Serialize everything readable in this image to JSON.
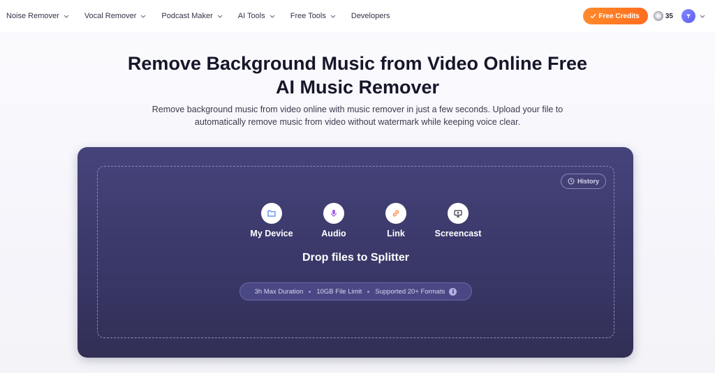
{
  "nav": {
    "items": [
      {
        "label": "Noise Remover",
        "dropdown": true
      },
      {
        "label": "Vocal Remover",
        "dropdown": true
      },
      {
        "label": "Podcast Maker",
        "dropdown": true
      },
      {
        "label": "AI Tools",
        "dropdown": true
      },
      {
        "label": "Free Tools",
        "dropdown": true
      },
      {
        "label": "Developers",
        "dropdown": false
      }
    ],
    "credits_label": "Free Credits",
    "coin_count": "35",
    "avatar_icon": "user-avatar-icon"
  },
  "hero": {
    "title_line1": "Remove Background Music from Video Online Free",
    "title_line2": "AI Music Remover",
    "subtitle_line1": "Remove background music from video online with music remover in just a few seconds. Upload your file to",
    "subtitle_line2": "automatically remove music from video without watermark while keeping voice clear."
  },
  "upload": {
    "history_label": "History",
    "sources": [
      {
        "label": "My Device",
        "icon": "folder-icon",
        "color": "#4a7cf0"
      },
      {
        "label": "Audio",
        "icon": "microphone-icon",
        "color": "#9b55e8"
      },
      {
        "label": "Link",
        "icon": "link-icon",
        "color": "#ff7a2f"
      },
      {
        "label": "Screencast",
        "icon": "monitor-icon",
        "color": "#2f2f3f"
      }
    ],
    "drop_text": "Drop files to Splitter",
    "limits": [
      "3h Max Duration",
      "10GB File Limit",
      "Supported 20+ Formats"
    ]
  },
  "colors": {
    "accent_orange": "#ff7a22",
    "panel_bg": "#3d3b6e"
  }
}
